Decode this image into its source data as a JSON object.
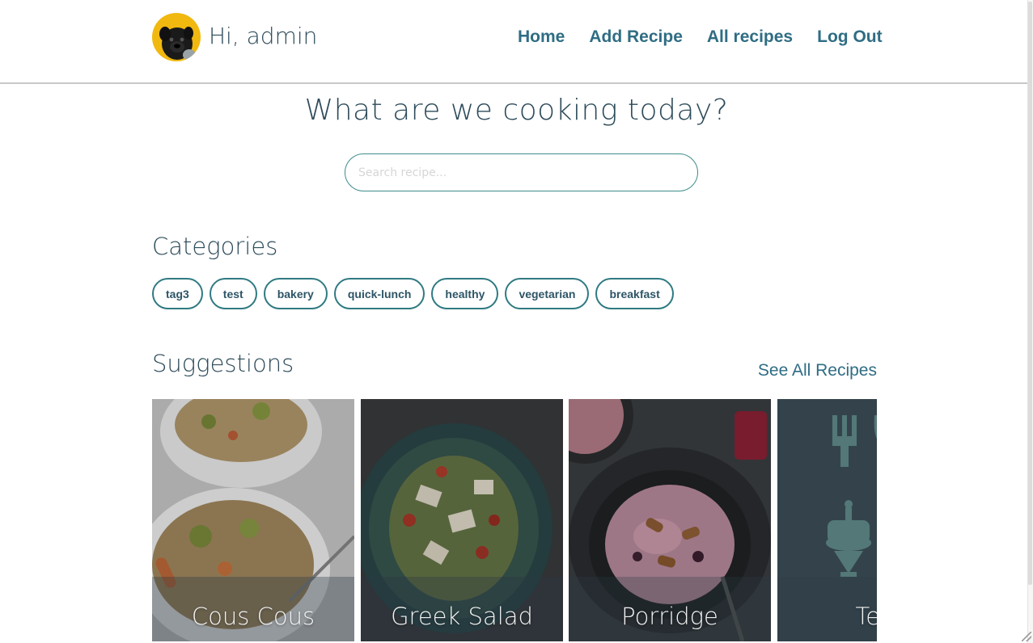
{
  "header": {
    "greeting": "Hi, admin",
    "avatar_icon": "pug-avatar-icon",
    "nav": [
      "Home",
      "Add Recipe",
      "All recipes",
      "Log Out"
    ]
  },
  "hero": {
    "title": "What are we cooking today?",
    "search_placeholder": "Search recipe..."
  },
  "categories": {
    "title": "Categories",
    "tags": [
      "tag3",
      "test",
      "bakery",
      "quick-lunch",
      "healthy",
      "vegetarian",
      "breakfast"
    ]
  },
  "suggestions": {
    "title": "Suggestions",
    "see_all": "See All Recipes",
    "cards": [
      {
        "title": "Cous Cous"
      },
      {
        "title": "Greek Salad"
      },
      {
        "title": "Porridge"
      },
      {
        "title": "Test"
      }
    ]
  },
  "colors": {
    "accent": "#2f6d84",
    "tag_border": "#2f7a82",
    "heading": "#2d4b5a",
    "avatar_bg": "#f1b80f"
  }
}
